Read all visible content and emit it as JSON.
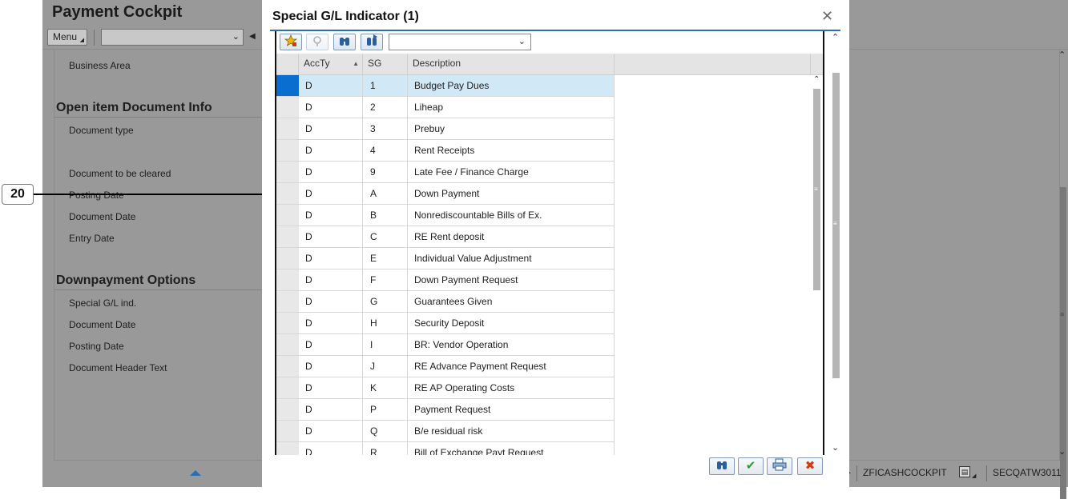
{
  "background": {
    "title": "Payment Cockpit",
    "menu_label": "Menu",
    "sections": {
      "business_area": "Business Area",
      "open_item_title": "Open item Document Info",
      "open_item_fields": [
        "Document type",
        "Document to be cleared",
        "Posting Date",
        "Document Date",
        "Entry Date"
      ],
      "downpayment_title": "Downpayment Options",
      "downpayment_fields": [
        "Special G/L ind.",
        "Document Date",
        "Posting Date",
        "Document Header Text"
      ]
    },
    "status": {
      "tcode": "ZFICASHCOCKPIT",
      "system": "SECQATW3011"
    }
  },
  "callout": {
    "number": "20"
  },
  "dialog": {
    "title": "Special G/L Indicator (1)",
    "close_icon": "close-icon",
    "toolbar_icons": [
      "add-favorite-icon",
      "help-icon",
      "find-icon",
      "find-next-icon"
    ],
    "variant_value": "",
    "columns": [
      "AccTy",
      "SG",
      "Description"
    ],
    "rows": [
      {
        "accty": "D",
        "sg": "1",
        "desc": "Budget Pay Dues",
        "selected": true
      },
      {
        "accty": "D",
        "sg": "2",
        "desc": "Liheap"
      },
      {
        "accty": "D",
        "sg": "3",
        "desc": "Prebuy"
      },
      {
        "accty": "D",
        "sg": "4",
        "desc": "Rent Receipts"
      },
      {
        "accty": "D",
        "sg": "9",
        "desc": "Late Fee / Finance Charge"
      },
      {
        "accty": "D",
        "sg": "A",
        "desc": "Down Payment"
      },
      {
        "accty": "D",
        "sg": "B",
        "desc": "Nonrediscountable Bills of Ex."
      },
      {
        "accty": "D",
        "sg": "C",
        "desc": "RE Rent deposit"
      },
      {
        "accty": "D",
        "sg": "E",
        "desc": "Individual Value Adjustment"
      },
      {
        "accty": "D",
        "sg": "F",
        "desc": "Down Payment Request"
      },
      {
        "accty": "D",
        "sg": "G",
        "desc": "Guarantees Given"
      },
      {
        "accty": "D",
        "sg": "H",
        "desc": "Security Deposit"
      },
      {
        "accty": "D",
        "sg": "I",
        "desc": "BR: Vendor Operation"
      },
      {
        "accty": "D",
        "sg": "J",
        "desc": "RE Advance Payment Request"
      },
      {
        "accty": "D",
        "sg": "K",
        "desc": "RE AP Operating Costs"
      },
      {
        "accty": "D",
        "sg": "P",
        "desc": "Payment Request"
      },
      {
        "accty": "D",
        "sg": "Q",
        "desc": "B/e residual risk"
      },
      {
        "accty": "D",
        "sg": "R",
        "desc": "Bill of Exchange Payt Request"
      }
    ],
    "footer_icons": [
      "find-icon",
      "confirm-icon",
      "print-icon",
      "cancel-icon"
    ],
    "colors": {
      "accent": "#2a6fb5",
      "selected_row": "#d1e8f6",
      "selected_marker": "#0a6ed1",
      "confirm": "#2e9a2e",
      "cancel": "#d23a0f"
    }
  }
}
